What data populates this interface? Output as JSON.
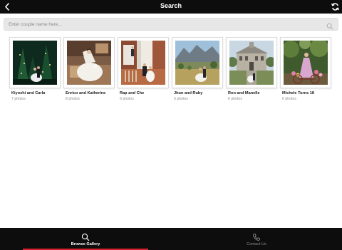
{
  "header": {
    "title": "Search",
    "back_icon": "chevron-left-icon",
    "refresh_icon": "refresh-icon"
  },
  "search": {
    "placeholder": "Enter couple name here...",
    "value": "",
    "icon": "search-icon"
  },
  "galleries": [
    {
      "name": "Kiyoshi and Carla",
      "photos": "7 photos",
      "scene": "night garden"
    },
    {
      "name": "Enrico and Katherine",
      "photos": "8 photos",
      "scene": "bride on sofa"
    },
    {
      "name": "Rap and Che",
      "photos": "6 photos",
      "scene": "indoor hallway"
    },
    {
      "name": "Jhun and Ruby",
      "photos": "5 photos",
      "scene": "mountain field"
    },
    {
      "name": "Ron and Manelle",
      "photos": "6 photos",
      "scene": "historic building"
    },
    {
      "name": "Michele Turns 18",
      "photos": "0 photos",
      "scene": "girl with bicycle"
    }
  ],
  "tabs": [
    {
      "label": "Browse Gallery",
      "icon": "search-icon",
      "active": true
    },
    {
      "label": "Contact Us",
      "icon": "phone-icon",
      "active": false
    }
  ],
  "colors": {
    "bar_background": "#0d0d0d",
    "active_tab_indicator": "#d9202f",
    "inactive_tab_text": "#8a8a8a"
  }
}
